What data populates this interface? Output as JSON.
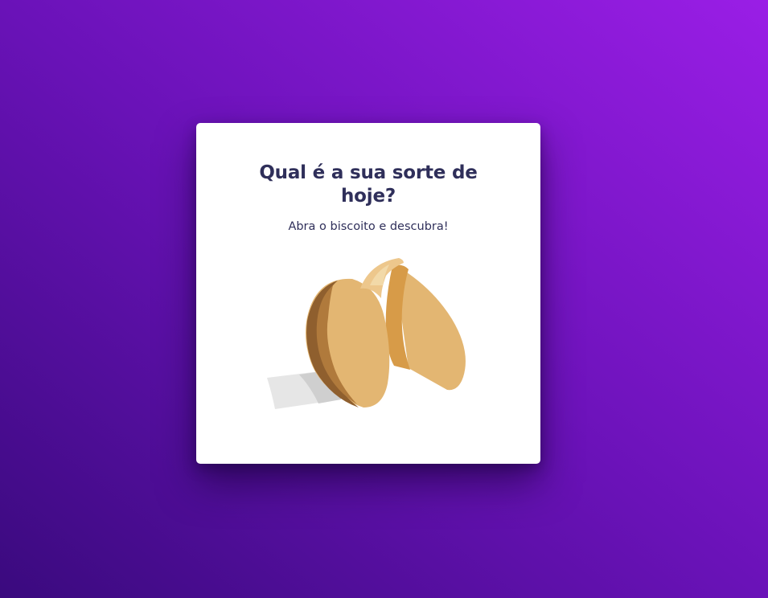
{
  "card": {
    "title": "Qual é a sua sorte de hoje?",
    "subtitle": "Abra o biscoito e descubra!"
  },
  "cookie": {
    "icon": "fortune-cookie-icon"
  },
  "colors": {
    "background_start": "#3a0a7e",
    "background_end": "#9a1ee6",
    "card": "#ffffff",
    "title_text": "#2f2f5a",
    "cookie_body": "#e3b672",
    "cookie_shadow": "#d79b48",
    "cookie_dark": "#8f5f2e",
    "paper": "#e6e6e6"
  }
}
